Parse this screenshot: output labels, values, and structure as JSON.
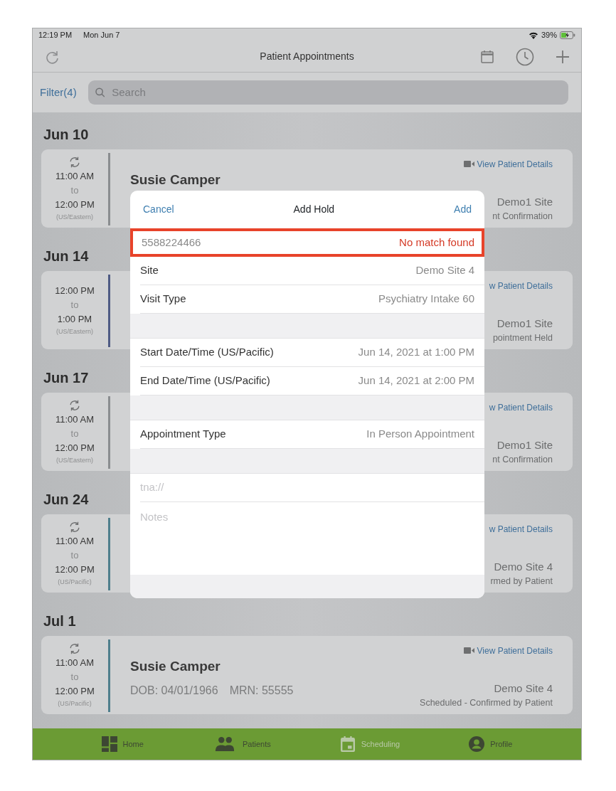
{
  "status_bar": {
    "time": "12:19 PM",
    "date": "Mon Jun 7",
    "battery": "39%"
  },
  "nav_bar": {
    "title": "Patient Appointments"
  },
  "filter": {
    "label": "Filter(4)"
  },
  "search": {
    "placeholder": "Search"
  },
  "appointments": [
    {
      "date": "Jun 10",
      "recurring": true,
      "start": "11:00 AM",
      "to": "to",
      "end": "12:00 PM",
      "timezone": "(US/Eastern)",
      "color": "#8a8d90",
      "name": "Susie Camper",
      "link": "View Patient Details",
      "link_icon": true,
      "site": "Demo1 Site",
      "status": "nt Confirmation"
    },
    {
      "date": "Jun 14",
      "recurring": false,
      "start": "12:00 PM",
      "to": "to",
      "end": "1:00 PM",
      "timezone": "(US/Eastern)",
      "color": "#4f5b84",
      "link": "w Patient Details",
      "link_icon": false,
      "site": "Demo1 Site",
      "status": "pointment Held"
    },
    {
      "date": "Jun 17",
      "recurring": true,
      "start": "11:00 AM",
      "to": "to",
      "end": "12:00 PM",
      "timezone": "(US/Eastern)",
      "color": "#8a8d90",
      "link": "w Patient Details",
      "link_icon": false,
      "site": "Demo1 Site",
      "status": "nt Confirmation"
    },
    {
      "date": "Jun 24",
      "recurring": true,
      "start": "11:00 AM",
      "to": "to",
      "end": "12:00 PM",
      "timezone": "(US/Pacific)",
      "color": "#4f7f8c",
      "link": "w Patient Details",
      "link_icon": false,
      "site": "Demo Site 4",
      "status": "rmed by Patient"
    },
    {
      "date": "Jul 1",
      "recurring": true,
      "start": "11:00 AM",
      "to": "to",
      "end": "12:00 PM",
      "timezone": "(US/Pacific)",
      "color": "#4f7f8c",
      "name": "Susie Camper",
      "dob": "DOB: 04/01/1966",
      "mrn": "MRN: 55555",
      "link": "View Patient Details",
      "link_icon": true,
      "site": "Demo Site 4",
      "status": "Scheduled - Confirmed by Patient"
    }
  ],
  "dialog": {
    "title": "Add Hold",
    "cancel": "Cancel",
    "confirm": "Add",
    "lookup": {
      "value": "5588224466",
      "result": "No match found",
      "highlighted": true
    },
    "rows": [
      {
        "kind": "row",
        "label": "Site",
        "value": "Demo Site 4"
      },
      {
        "kind": "row",
        "label": "Visit Type",
        "value": "Psychiatry Intake 60"
      },
      {
        "kind": "spacer"
      },
      {
        "kind": "row",
        "label": "Start Date/Time (US/Pacific)",
        "value": "Jun 14, 2021 at 1:00 PM"
      },
      {
        "kind": "row",
        "label": "End Date/Time (US/Pacific)",
        "value": "Jun 14, 2021 at 2:00 PM"
      },
      {
        "kind": "spacer"
      },
      {
        "kind": "row",
        "label": "Appointment Type",
        "value": "In Person Appointment"
      },
      {
        "kind": "spacer"
      },
      {
        "kind": "input",
        "placeholder": "tna://"
      },
      {
        "kind": "notes",
        "placeholder": "Notes"
      }
    ]
  },
  "tab_bar": [
    {
      "label": "Home",
      "selected": false
    },
    {
      "label": "Patients",
      "selected": false
    },
    {
      "label": "Scheduling",
      "selected": true
    },
    {
      "label": "Profile",
      "selected": false
    }
  ]
}
